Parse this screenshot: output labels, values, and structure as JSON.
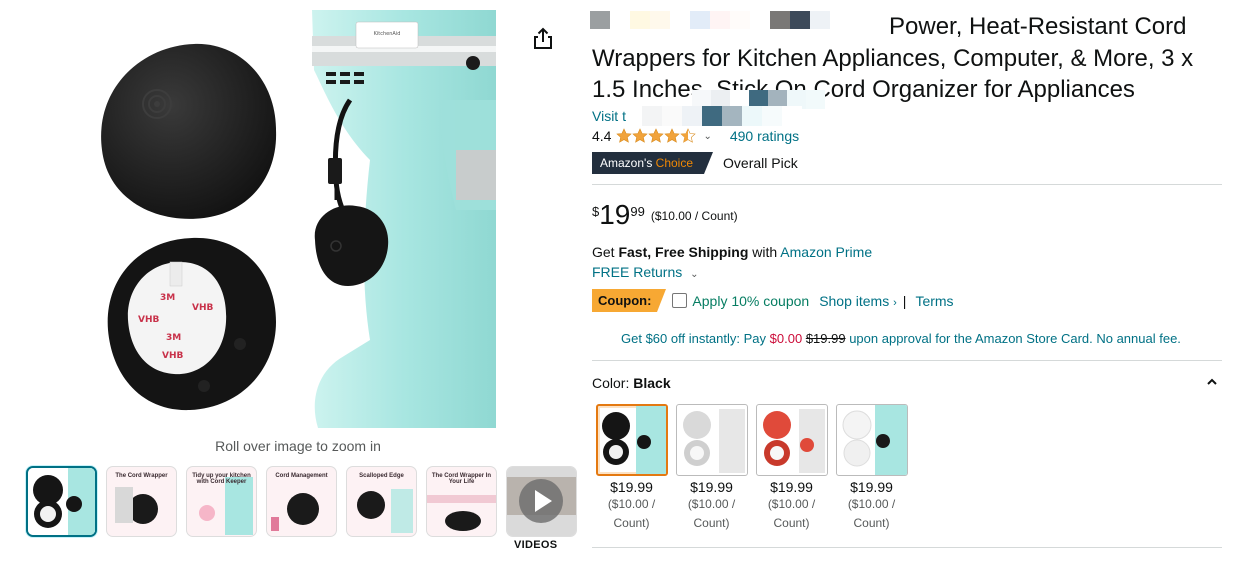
{
  "gallery": {
    "zoom_hint": "Roll over image to zoom in",
    "videos_label": "VIDEOS",
    "thumbnails": [
      {
        "caption": "",
        "selected": true
      },
      {
        "caption": "The Cord Wrapper"
      },
      {
        "caption": "Tidy up your kitchen with Cord Keeper"
      },
      {
        "caption": "Cord Management"
      },
      {
        "caption": "Scalloped Edge"
      },
      {
        "caption": "The Cord Wrapper In Your Life"
      },
      {
        "caption": "",
        "video": true
      }
    ],
    "main_image_text": [
      "3M",
      "VHB",
      "VHB",
      "3M",
      "VHB"
    ]
  },
  "product": {
    "title_line1": "Power, Heat-Resistant Cord",
    "title_rest": "Wrappers for Kitchen Appliances, Computer, & More, 3 x 1.5 Inches, Stick On Cord Organizer for Appliances",
    "store_link": "Visit t",
    "rating_value": "4.4",
    "rating_stars": 4.4,
    "ratings_count": "490 ratings",
    "badge_prefix": "Amazon's",
    "badge_choice": "Choice",
    "badge_pick": "Overall Pick"
  },
  "price": {
    "symbol": "$",
    "whole": "19",
    "fraction": "99",
    "per_unit": "($10.00 / Count)"
  },
  "shipping": {
    "get": "Get",
    "fast_free": "Fast, Free Shipping",
    "with": "with",
    "prime": "Amazon Prime",
    "returns": "FREE Returns"
  },
  "coupon": {
    "badge": "Coupon:",
    "apply": "Apply 10% coupon",
    "shop_items": "Shop items",
    "divider": "|",
    "terms": "Terms"
  },
  "card_offer": {
    "prefix": "Get $60 off instantly: Pay",
    "pay": "$0.00",
    "original": "$19.99",
    "suffix": "upon approval for the Amazon Store Card. No annual fee."
  },
  "color": {
    "label": "Color:",
    "value": "Black",
    "options": [
      {
        "name": "Black",
        "price": "$19.99",
        "unit_line1": "($10.00 /",
        "unit_line2": "Count)",
        "selected": true
      },
      {
        "name": "White",
        "price": "$19.99",
        "unit_line1": "($10.00 /",
        "unit_line2": "Count)"
      },
      {
        "name": "Red",
        "price": "$19.99",
        "unit_line1": "($10.00 /",
        "unit_line2": "Count)"
      },
      {
        "name": "White",
        "price": "$19.99",
        "unit_line1": "($10.00 /",
        "unit_line2": "Count)"
      }
    ]
  },
  "colors": {
    "link": "#007185",
    "badge_bg": "#232f3e",
    "choice_orange": "#f08804",
    "coupon_bg": "#f7a833",
    "mixer_aqua": "#a8e6e1",
    "selected_border": "#e47911"
  }
}
